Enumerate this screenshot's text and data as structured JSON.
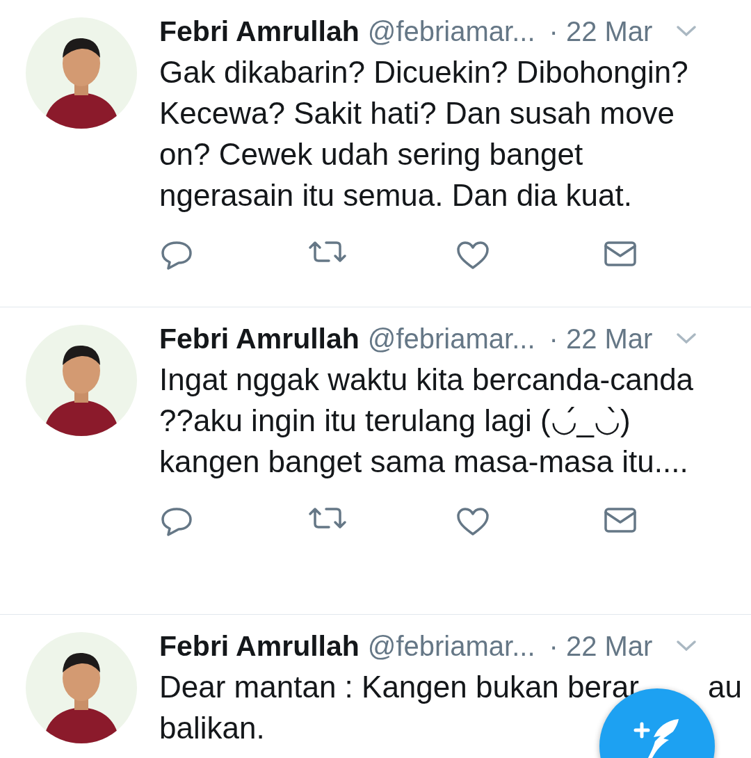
{
  "tweets": [
    {
      "name": "Febri Amrullah",
      "handle": "@febriamar...",
      "date": "· 22 Mar",
      "text": "Gak dikabarin? Dicuekin? Dibohongin? Kecewa? Sakit hati? Dan susah move on? Cewek udah sering banget ngerasain itu semua. Dan dia kuat."
    },
    {
      "name": "Febri Amrullah",
      "handle": "@febriamar...",
      "date": "· 22 Mar",
      "text": "Ingat nggak waktu kita bercanda-canda ??aku ingin itu terulang lagi (◡́_◡̀) kangen banget sama masa-masa itu...."
    },
    {
      "name": "Febri Amrullah",
      "handle": "@febriamar...",
      "date": "· 22 Mar",
      "text": "Dear mantan : Kangen bukan berar",
      "text_after_button": "au",
      "text_line_2": "balikan."
    }
  ]
}
